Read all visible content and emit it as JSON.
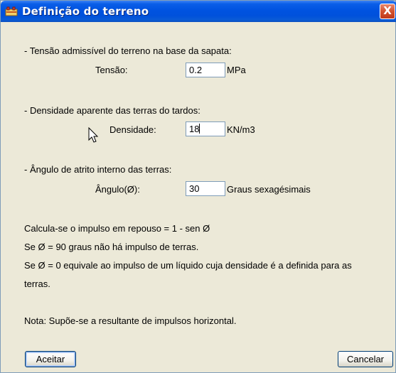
{
  "window": {
    "title": "Definição do terreno",
    "close_glyph": "X"
  },
  "tensao_section": {
    "heading": "- Tensão admissível do terreno na base da sapata:",
    "label": "Tensão:",
    "value": "0.2",
    "unit": "MPa"
  },
  "densidade_section": {
    "heading": "- Densidade aparente das terras do tardos:",
    "label": "Densidade:",
    "value": "18",
    "unit": "KN/m3"
  },
  "angulo_section": {
    "heading": "- Ângulo de atrito interno das terras:",
    "label": "Ângulo(Ø):",
    "value": "30",
    "unit": "Graus sexagésimais"
  },
  "notes": {
    "line1": "Calcula-se o impulso em repouso = 1 - sen Ø",
    "line2": "Se Ø = 90 graus não há impulso de terras.",
    "line3": "Se Ø = 0 equivale ao impulso de um líquido cuja densidade é a definida para as",
    "line4": "terras.",
    "line5": "Nota: Supõe-se a resultante de impulsos horizontal."
  },
  "buttons": {
    "ok_label": "Aceitar",
    "cancel_label": "Cancelar"
  },
  "icons": {
    "title_icon": "app-icon",
    "cursor": "mouse-pointer-icon"
  },
  "colors": {
    "titlebar": "#0053e0",
    "dialog_bg": "#ece9d8",
    "close_button": "#d2532f"
  }
}
